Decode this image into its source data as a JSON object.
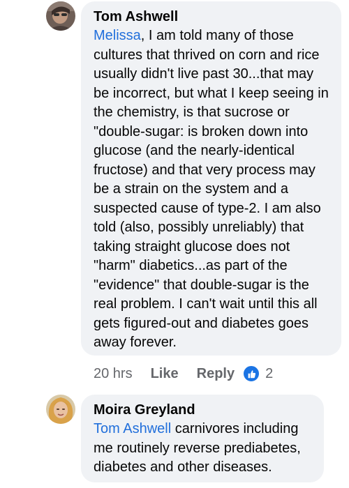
{
  "comments": [
    {
      "author": "Tom Ashwell",
      "mention": "Melissa",
      "text": ", I am told many of those cultures that thrived on corn and rice usually didn't live past 30...that may be incorrect, but what I keep seeing in the chemistry, is that sucrose or \"double-sugar: is broken down into glucose (and the nearly-identical fructose) and that very process may be a strain on the system and a suspected cause of type-2. I am also told (also, possibly unreliably) that taking straight glucose does not \"harm\" diabetics...as part of the \"evidence\" that double-sugar is the real problem. I can't wait until this all gets figured-out and diabetes goes away forever.",
      "time": "20 hrs",
      "like_label": "Like",
      "reply_label": "Reply",
      "reaction_icon": "like-icon",
      "reaction_count": "2"
    },
    {
      "author": "Moira Greyland",
      "mention": "Tom Ashwell",
      "text": " carnivores including me routinely reverse prediabetes, diabetes and other diseases."
    }
  ],
  "colors": {
    "bubble": "#f0f2f5",
    "mention": "#216fdb",
    "meta": "#65676b",
    "like_badge": "#1b74e4"
  }
}
